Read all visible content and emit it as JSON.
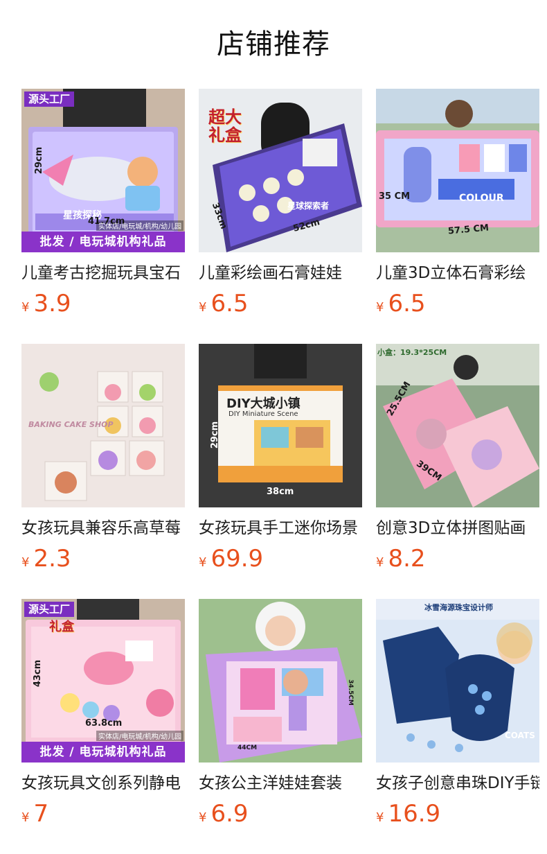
{
  "page": {
    "title": "店铺推荐"
  },
  "colors": {
    "price": "#e8501d",
    "badge": "#8a33c9"
  },
  "products": [
    {
      "title": "儿童考古挖掘玩具宝石",
      "currency": "¥",
      "price": "3.9",
      "badge_top": "源头工厂",
      "badge_bottom": "批发 / 电玩城机构礼品",
      "box_label": "星孩探秘",
      "dim_w": "41.7cm",
      "dim_h": "29cm",
      "dim_note": "实体店/电玩城/机构/幼儿园"
    },
    {
      "title": "儿童彩绘画石膏娃娃",
      "currency": "¥",
      "price": "6.5",
      "sticker": "超大礼盒",
      "box_label": "星球探索者",
      "dim_w": "52cm",
      "dim_h": "33cm"
    },
    {
      "title": "儿童3D立体石膏彩绘",
      "currency": "¥",
      "price": "6.5",
      "box_label": "COLOUR",
      "dim_w": "57.5 CM",
      "dim_h": "35 CM"
    },
    {
      "title": "女孩玩具兼容乐高草莓",
      "currency": "¥",
      "price": "2.3",
      "box_label": "BAKING CAKE SHOP"
    },
    {
      "title": "女孩玩具手工迷你场景",
      "currency": "¥",
      "price": "69.9",
      "box_label": "DIY大城小镇",
      "box_sub": "DIY Miniature Scene",
      "dim_w": "38cm",
      "dim_h": "29cm"
    },
    {
      "title": "创意3D立体拼图贴画",
      "currency": "¥",
      "price": "8.2",
      "dim_top": "小盒：19.3*25CM",
      "dim_w": "39CM",
      "dim_h": "25.5CM"
    },
    {
      "title": "女孩玩具文创系列静电",
      "currency": "¥",
      "price": "7",
      "badge_top": "源头工厂",
      "badge_bottom": "批发 / 电玩城机构礼品",
      "sticker": "礼盒",
      "dim_w": "63.8cm",
      "dim_h": "43cm",
      "dim_note": "实体店/电玩城/机构/幼儿园"
    },
    {
      "title": "女孩公主洋娃娃套装",
      "currency": "¥",
      "price": "6.9",
      "dim_w": "44CM",
      "dim_h": "34.5CM"
    },
    {
      "title": "女孩子创意串珠DIY手链",
      "currency": "¥",
      "price": "16.9",
      "box_label": "冰雪海源珠宝设计师",
      "box_sub": "COATS"
    }
  ]
}
